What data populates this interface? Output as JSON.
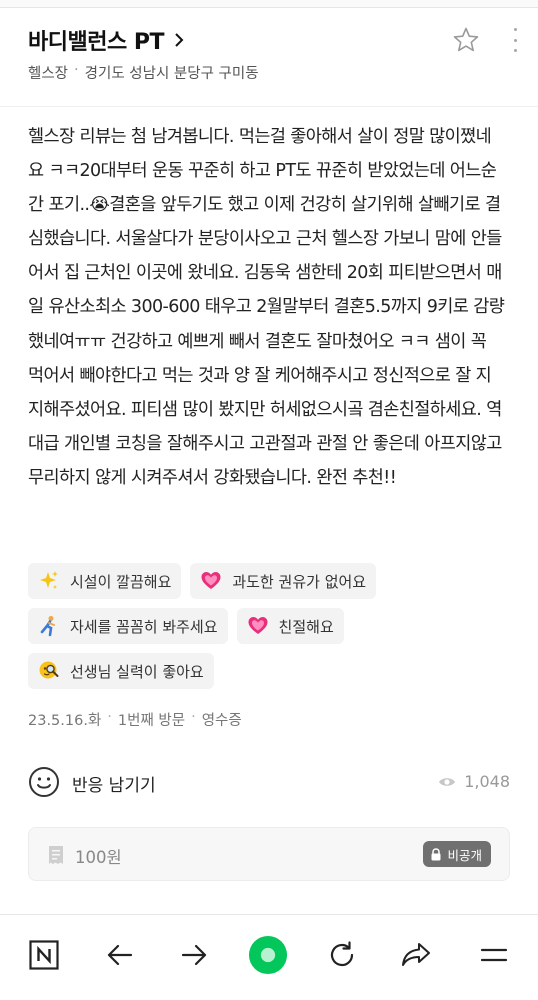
{
  "header": {
    "place_name": "바디밸런스 PT",
    "category": "헬스장",
    "address": "경기도 성남시 분당구 구미동"
  },
  "review": {
    "body": "헬스장 리뷰는 첨 남겨봅니다. 먹는걸 좋아해서 살이 정말 많이쪘네요 ㅋㅋ20대부터 운동 꾸준히 하고 PT도 뀨준히 받았었는데 어느순간 포기..😭결혼을 앞두기도 했고 이제 건강히 살기위해 살빼기로 결심했습니다. 서울살다가 분당이사오고 근처 헬스장 가보니 맘에 안들어서 집 근처인 이곳에 왔네요. 김동욱 샘한테 20회 피티받으면서 매일 유산소최소 300-600 태우고 2월말부터 결혼5.5까지 9키로 감량했네여ㅠㅠ 건강하고 예쁘게 빼서 결혼도 잘마쳤어오 ㅋㅋ 샘이 꼭 먹어서 빼야한다고 먹는 것과 양 잘 케어해주시고 정신적으로 잘 지지해주셨어요. 피티샘 많이 봤지만 허세없으시곸 겸손친절하세요. 역대급 개인별 코칭을 잘해주시고 고관절과 관절 안 좋은데 아프지않고 무리하지 않게 시켜주셔서 강화됐습니다. 완전 추천!!"
  },
  "tags": [
    {
      "label": "시설이 깔끔해요",
      "icon": "sparkles-icon"
    },
    {
      "label": "과도한 권유가 없어요",
      "icon": "heart-icon"
    },
    {
      "label": "자세를 꼼꼼히 봐주세요",
      "icon": "exercise-person-icon"
    },
    {
      "label": "친절해요",
      "icon": "heart-icon"
    },
    {
      "label": "선생님 실력이 좋아요",
      "icon": "magnifier-face-icon"
    }
  ],
  "meta": {
    "date": "23.5.16.화",
    "visit": "1번째 방문",
    "proof": "영수증"
  },
  "reaction": {
    "label": "반응 남기기",
    "views": "1,048"
  },
  "price": {
    "amount": "100원",
    "private_label": "비공개"
  },
  "colors": {
    "accent_green": "#03c75a",
    "text_primary": "#222222",
    "text_secondary": "#777777",
    "tag_bg": "#f3f3f3"
  },
  "bottom_nav": [
    "naver-logo-icon",
    "back-arrow-icon",
    "forward-arrow-icon",
    "home-green-icon",
    "refresh-icon",
    "share-icon",
    "menu-icon"
  ]
}
